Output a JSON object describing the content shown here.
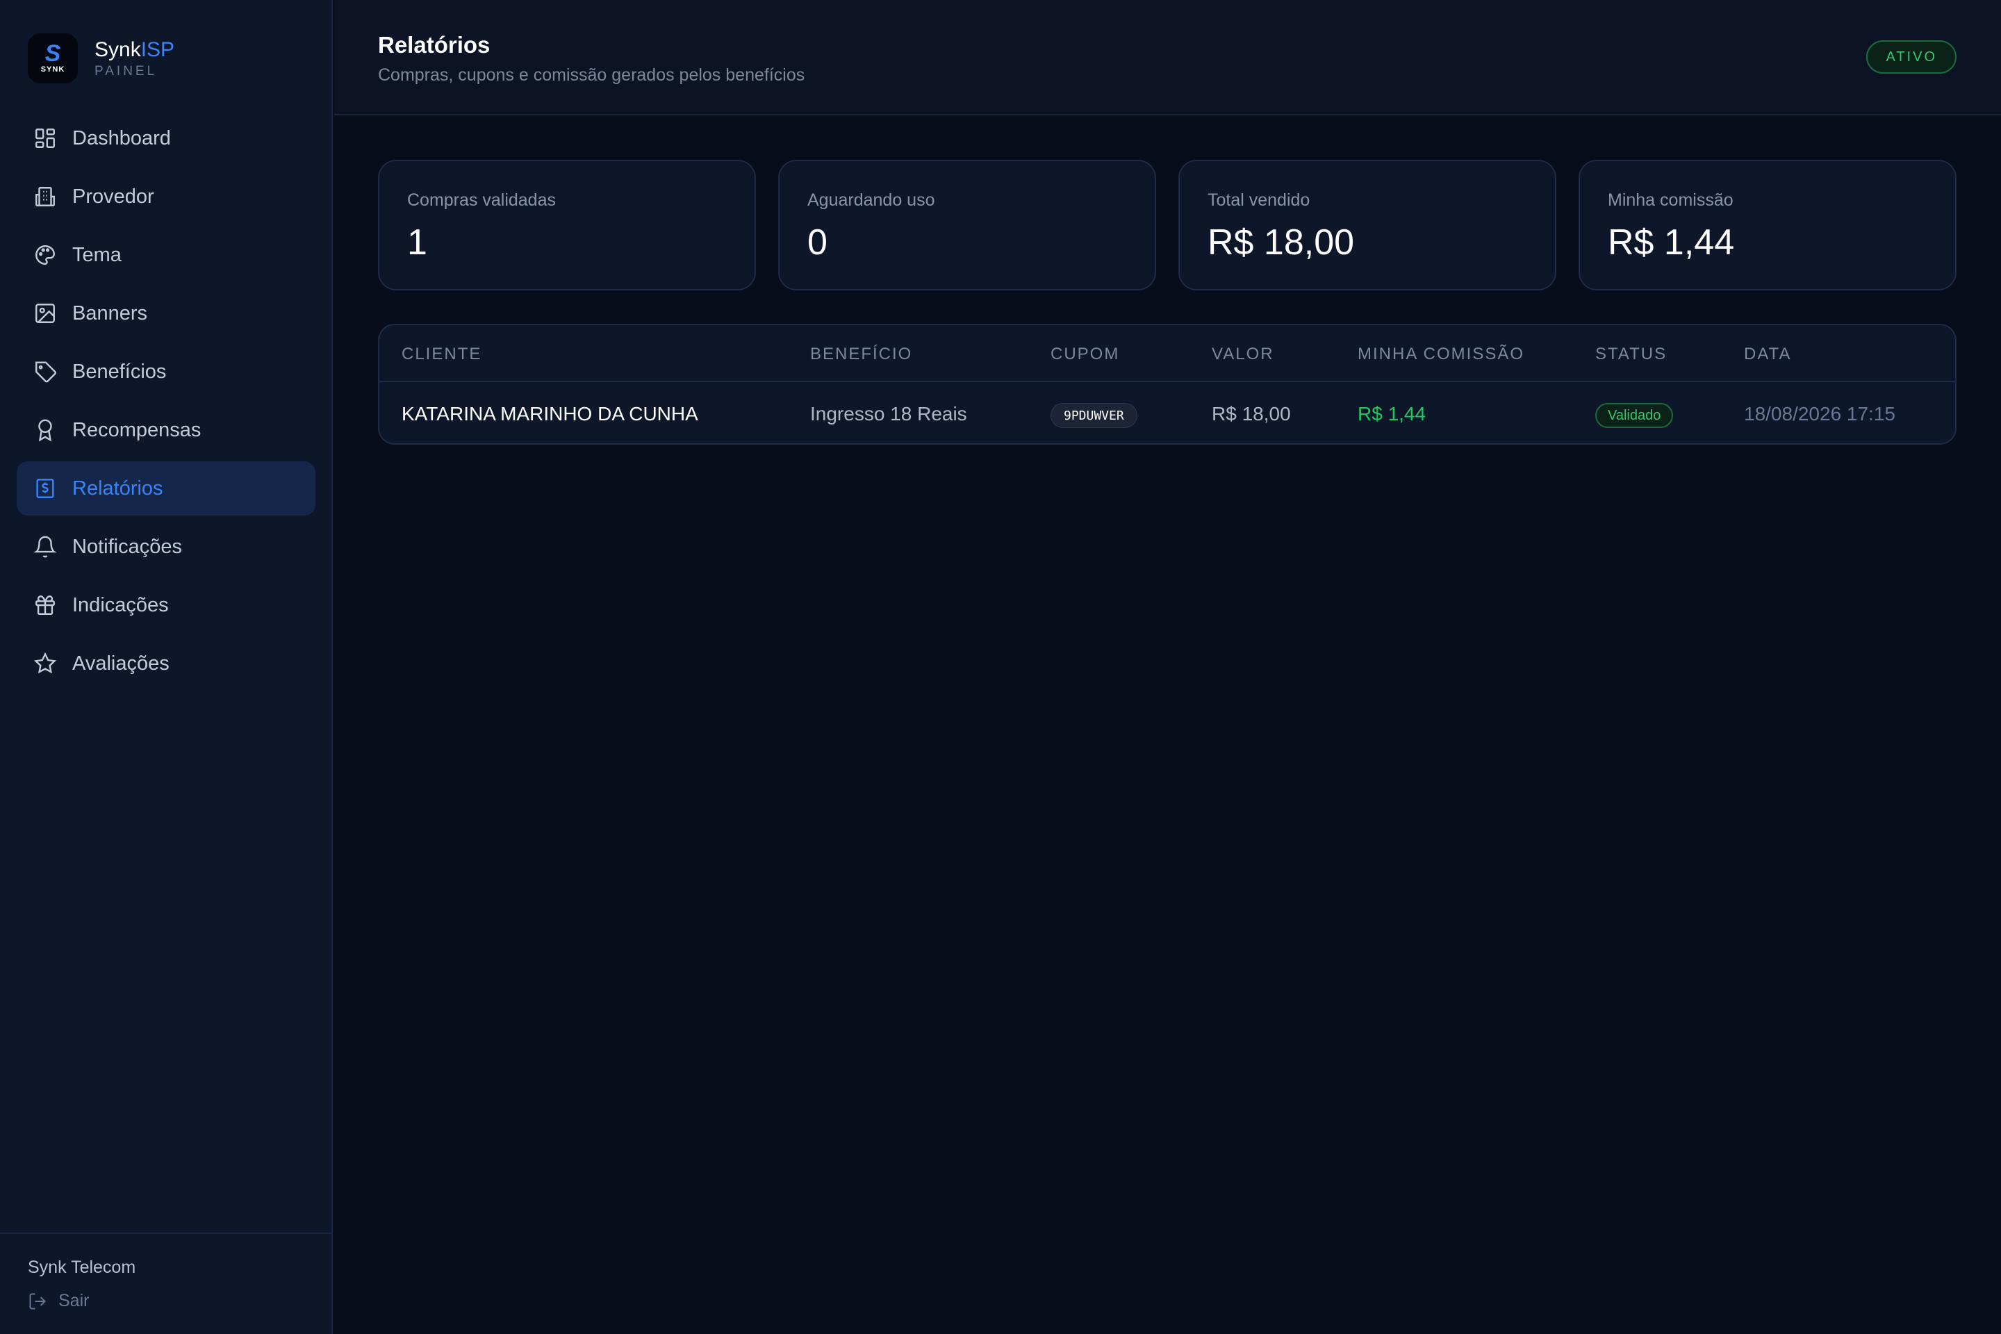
{
  "brand": {
    "name_main": "Synk",
    "name_accent": "ISP",
    "subtitle": "PAINEL",
    "logo_mark": "S",
    "logo_word": "SYNK"
  },
  "sidebar": {
    "items": [
      {
        "label": "Dashboard",
        "icon": "grid-icon"
      },
      {
        "label": "Provedor",
        "icon": "building-icon"
      },
      {
        "label": "Tema",
        "icon": "palette-icon"
      },
      {
        "label": "Banners",
        "icon": "image-icon"
      },
      {
        "label": "Benefícios",
        "icon": "tag-icon"
      },
      {
        "label": "Recompensas",
        "icon": "award-icon"
      },
      {
        "label": "Relatórios",
        "icon": "receipt-icon",
        "active": true
      },
      {
        "label": "Notificações",
        "icon": "bell-icon"
      },
      {
        "label": "Indicações",
        "icon": "gift-icon"
      },
      {
        "label": "Avaliações",
        "icon": "star-icon"
      }
    ],
    "footer": {
      "company": "Synk Telecom",
      "logout_label": "Sair"
    }
  },
  "header": {
    "title": "Relatórios",
    "subtitle": "Compras, cupons e comissão gerados pelos benefícios",
    "status": "ATIVO"
  },
  "stats": [
    {
      "label": "Compras validadas",
      "value": "1"
    },
    {
      "label": "Aguardando uso",
      "value": "0"
    },
    {
      "label": "Total vendido",
      "value": "R$ 18,00"
    },
    {
      "label": "Minha comissão",
      "value": "R$ 1,44"
    }
  ],
  "table": {
    "columns": [
      "CLIENTE",
      "BENEFÍCIO",
      "CUPOM",
      "VALOR",
      "MINHA COMISSÃO",
      "STATUS",
      "DATA"
    ],
    "rows": [
      {
        "cliente": "KATARINA MARINHO DA CUNHA",
        "beneficio": "Ingresso 18 Reais",
        "cupom": "9PDUWVER",
        "valor": "R$ 18,00",
        "comissao": "R$ 1,44",
        "status": "Validado",
        "data": "18/08/2026 17:15"
      }
    ]
  },
  "colors": {
    "accent": "#3b82f6",
    "background": "#070d1a",
    "sidebar": "#0e1629",
    "success": "#22c55e"
  }
}
